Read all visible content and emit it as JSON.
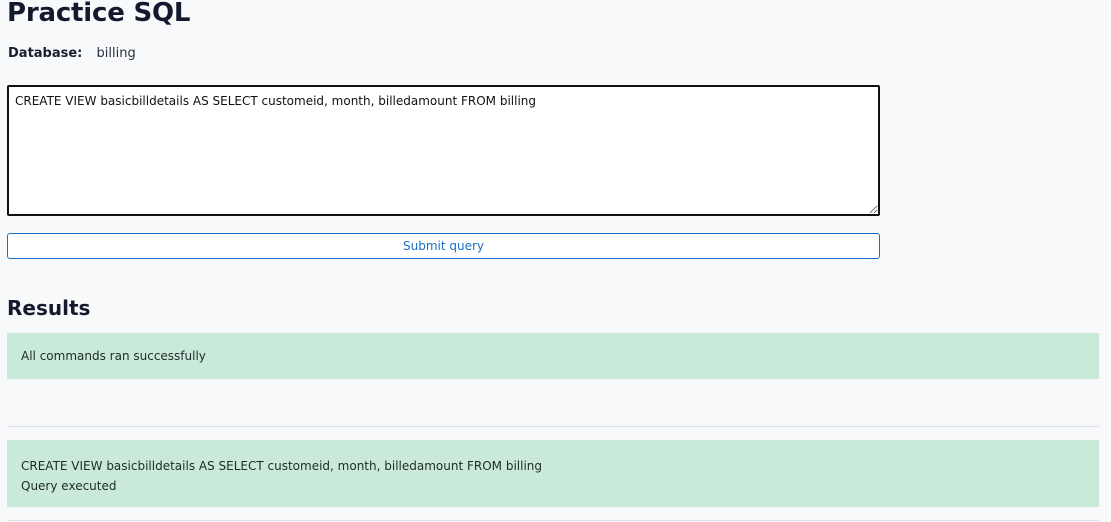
{
  "page": {
    "title": "Practice SQL",
    "database_label": "Database:",
    "database_value": "billing"
  },
  "editor": {
    "query": "CREATE VIEW basicbilldetails AS SELECT customeid, month, billedamount FROM billing"
  },
  "actions": {
    "submit_label": "Submit query"
  },
  "results": {
    "heading": "Results",
    "status_message": "All commands ran successfully",
    "entries": [
      {
        "statement": "CREATE VIEW basicbilldetails AS SELECT customeid, month, billedamount FROM billing",
        "outcome": "Query executed"
      }
    ]
  },
  "colors": {
    "success_background": "#c9ead8",
    "accent": "#1a6fc4"
  }
}
